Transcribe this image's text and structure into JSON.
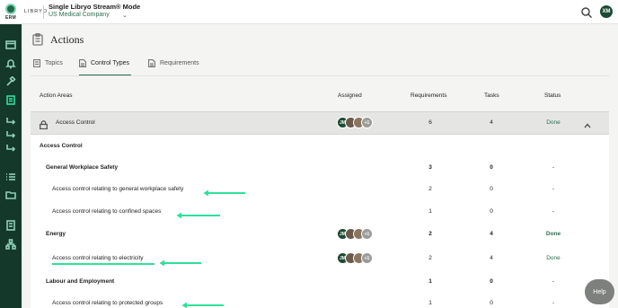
{
  "topbar": {
    "brand": "LIBRYO",
    "logo_text": "ERM",
    "mode_title": "Single Libryo Stream® Mode",
    "company": "US Medical Company",
    "user_initials": "XM"
  },
  "page": {
    "title": "Actions"
  },
  "tabs": [
    {
      "label": "Topics",
      "icon": "topics-icon"
    },
    {
      "label": "Control Types",
      "icon": "document-icon"
    },
    {
      "label": "Requirements",
      "icon": "document-icon"
    }
  ],
  "table": {
    "headers": {
      "action_areas": "Action Areas",
      "assigned": "Assigned",
      "requirements": "Requirements",
      "tasks": "Tasks",
      "status": "Status"
    },
    "section": {
      "label": "Access Control",
      "requirements": "6",
      "tasks": "4",
      "status": "Done",
      "assignees": [
        "JM",
        "",
        "",
        "+1"
      ]
    },
    "subheading": "Access Control",
    "rows": [
      {
        "label": "General Workplace Safety",
        "requirements": "3",
        "tasks": "0",
        "status": "-"
      },
      {
        "label": "Access control relating to general workplace safety",
        "requirements": "2",
        "tasks": "0",
        "status": "-"
      },
      {
        "label": "Access control relating to confined spaces",
        "requirements": "1",
        "tasks": "0",
        "status": "-"
      },
      {
        "label": "Energy",
        "requirements": "2",
        "tasks": "4",
        "status": "Done",
        "assignees": [
          "JM",
          "",
          "",
          "+1"
        ]
      },
      {
        "label": "Access control relating to electricity",
        "requirements": "2",
        "tasks": "4",
        "status": "Done",
        "assignees": [
          "JM",
          "",
          "",
          "+1"
        ]
      },
      {
        "label": "Labour and Employment",
        "requirements": "1",
        "tasks": "0",
        "status": "-"
      },
      {
        "label": "Access control relating to protected groups",
        "requirements": "1",
        "tasks": "0",
        "status": "-"
      }
    ]
  },
  "help": {
    "label": "Help"
  },
  "colors": {
    "accent": "#2c6e4e",
    "arrow": "#2ee09a",
    "rail": "#14382a"
  }
}
